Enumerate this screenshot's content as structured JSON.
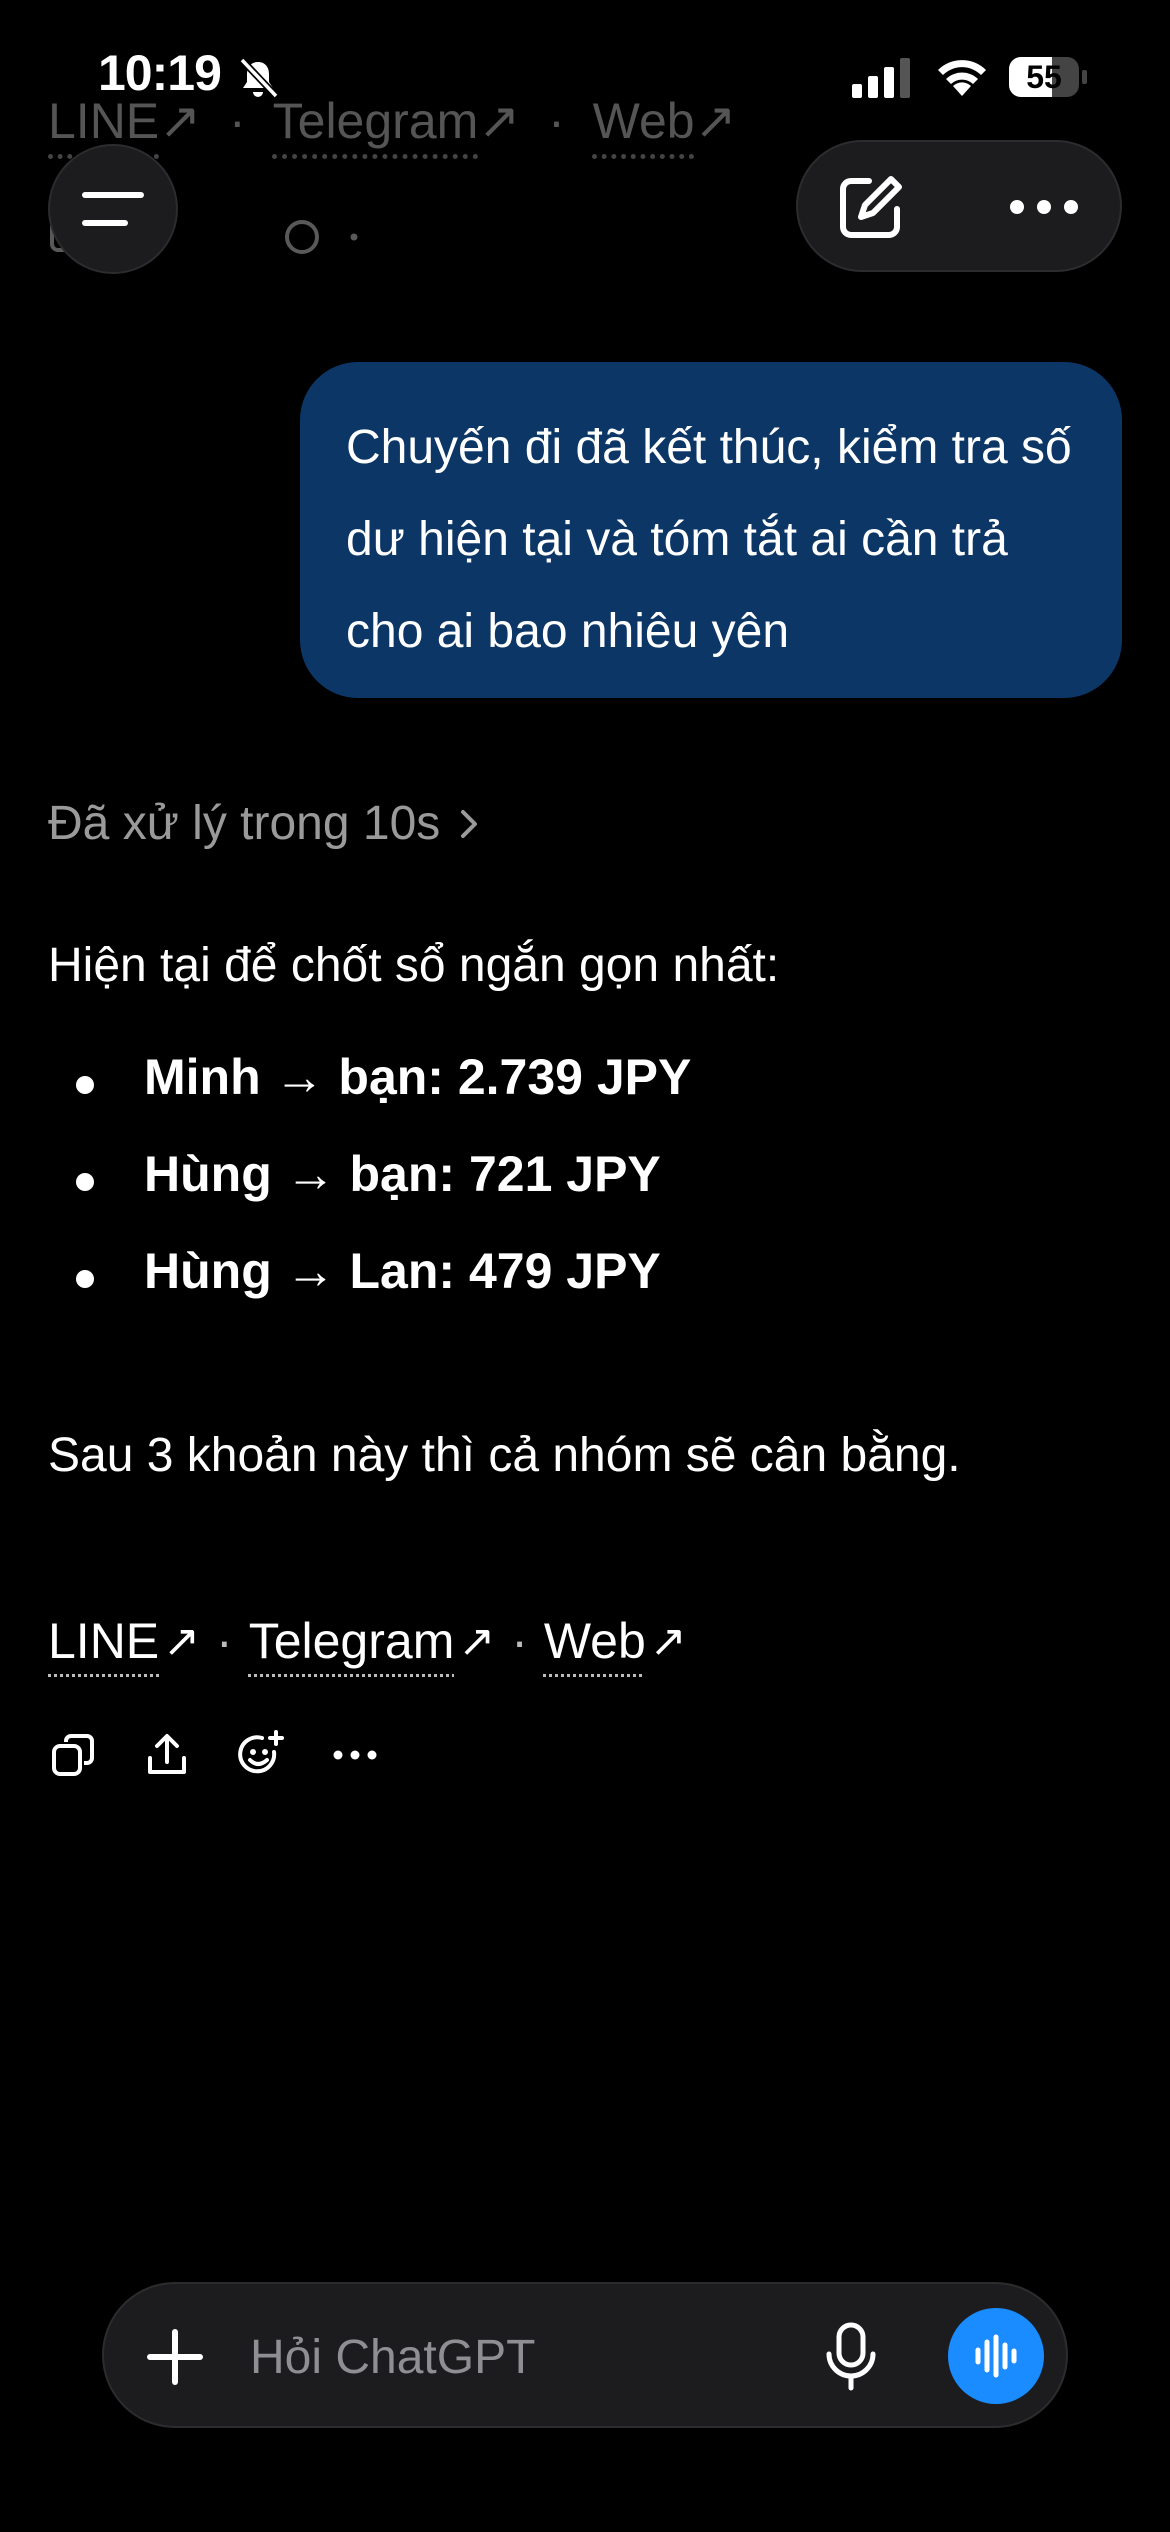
{
  "status_bar": {
    "time": "10:19",
    "battery": "55"
  },
  "previous_message": {
    "links": [
      {
        "label": "LINE",
        "arrow": "↗"
      },
      {
        "label": "Telegram",
        "arrow": "↗"
      },
      {
        "label": "Web",
        "arrow": "↗"
      }
    ],
    "separator": "·"
  },
  "conversation": {
    "user_message": "Chuyến đi đã kết thúc, kiểm tra số dư hiện tại và tóm tắt ai cần trả cho ai bao nhiêu yên",
    "thought_label": "Đã xử lý trong 10s",
    "intro": "Hiện tại để chốt sổ ngắn gọn nhất:",
    "bullets": [
      "Minh → bạn: 2.739 JPY",
      "Hùng → bạn: 721 JPY",
      "Hùng → Lan: 479 JPY"
    ],
    "summary": "Sau 3 khoản này thì cả nhóm sẽ cân bằng.",
    "links": [
      {
        "label": "LINE",
        "arrow": "↗"
      },
      {
        "label": "Telegram",
        "arrow": "↗"
      },
      {
        "label": "Web",
        "arrow": "↗"
      }
    ],
    "separator": "·",
    "action_icons": [
      "copy-icon",
      "share-icon",
      "add-reaction-icon",
      "more-icon"
    ]
  },
  "composer": {
    "placeholder": "Hỏi ChatGPT"
  },
  "colors": {
    "background": "#000000",
    "user_bubble": "#0b3666",
    "voice_button": "#1a8cff",
    "muted_text": "#9a9a9a"
  }
}
